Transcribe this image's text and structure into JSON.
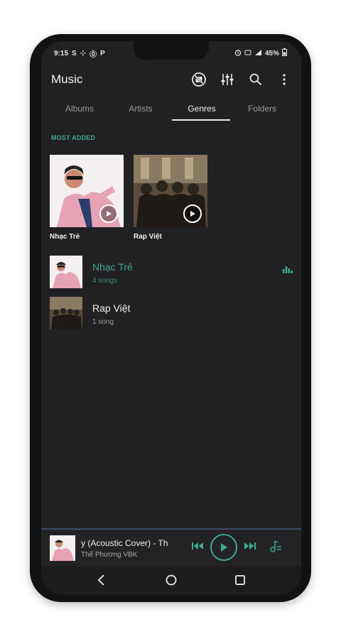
{
  "status": {
    "time": "9:15",
    "left_icons": [
      "S",
      "⊹",
      "⓪",
      "P"
    ],
    "battery_text": "45%"
  },
  "app": {
    "title": "Music"
  },
  "tabs": [
    {
      "label": "Albums"
    },
    {
      "label": "Artists"
    },
    {
      "label": "Genres"
    },
    {
      "label": "Folders"
    }
  ],
  "active_tab": "Genres",
  "section": {
    "label": "MOST ADDED"
  },
  "tiles": [
    {
      "label": "Nhạc Trẻ"
    },
    {
      "label": "Rap Việt"
    }
  ],
  "list": [
    {
      "title": "Nhạc Trẻ",
      "subtitle": "4 songs",
      "active": true
    },
    {
      "title": "Rap Việt",
      "subtitle": "1 song",
      "active": false
    }
  ],
  "player": {
    "title": "y (Acoustic Cover) - Th",
    "artist": "Thế Phương VBK"
  },
  "colors": {
    "accent": "#3fa88a",
    "background": "#212124"
  }
}
